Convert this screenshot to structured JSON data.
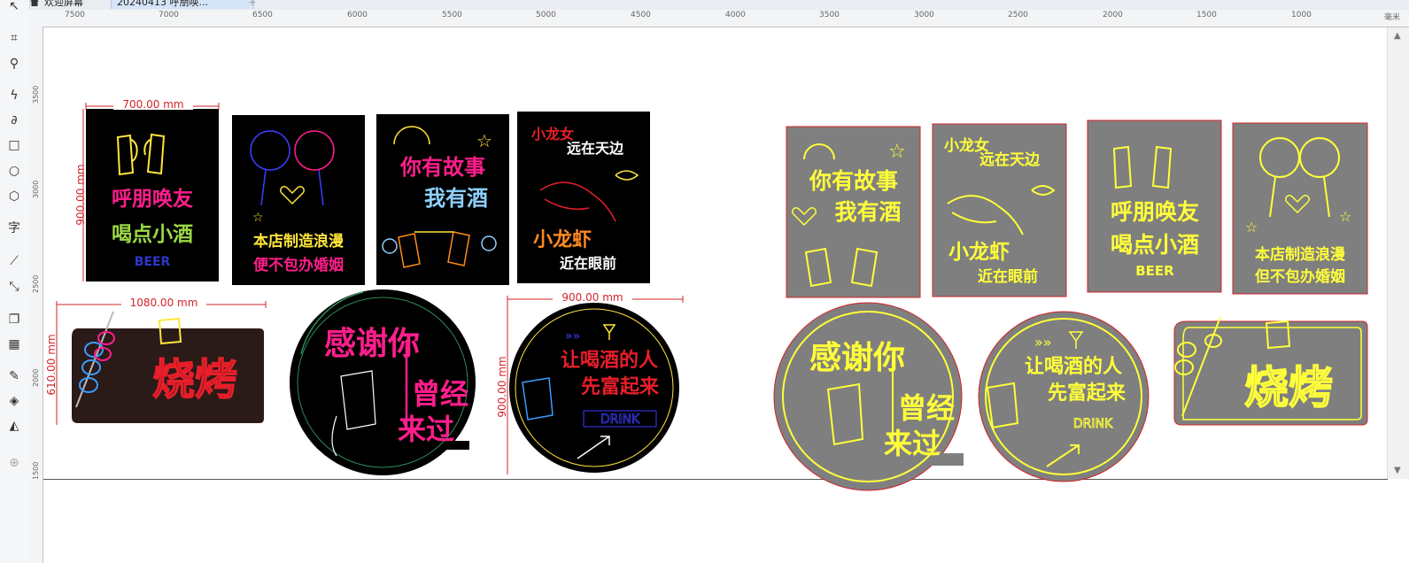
{
  "tabs": {
    "home": "欢迎屏幕",
    "doc": "20240413 呼朋唤..."
  },
  "ruler": {
    "h_labels": [
      "7500",
      "7000",
      "6500",
      "6000",
      "5500",
      "5000",
      "4500",
      "4000",
      "3500",
      "3000",
      "2500",
      "2000",
      "1500",
      "1000",
      "毫米"
    ],
    "v_labels": [
      "3500",
      "3000",
      "2500",
      "2000",
      "1500"
    ]
  },
  "dims": {
    "w700": "700.00 mm",
    "h900": "900.00 mm",
    "w1080": "1080.00 mm",
    "h610": "610.00 mm",
    "w900": "900.00 mm",
    "h900b": "900.00 mm"
  },
  "signs": {
    "s1": {
      "line1": "呼朋唤友",
      "line2": "喝点小酒",
      "line3": "BEER"
    },
    "s2": {
      "line1": "本店制造浪漫",
      "line2": "便不包办婚姻"
    },
    "s3": {
      "line1": "你有故事",
      "line2": "我有酒"
    },
    "s4": {
      "line1": "小龙女",
      "line2": "远在天边",
      "line3": "小龙虾",
      "line4": "近在眼前"
    },
    "s5": {
      "text": "烧烤"
    },
    "s6": {
      "line1": "感谢你",
      "line2": "曾经",
      "line3": "来过"
    },
    "s7": {
      "line1": "让喝酒的人",
      "line2": "先富起来",
      "line3": "DRINK"
    },
    "g1": {
      "line1": "你有故事",
      "line2": "我有酒"
    },
    "g2": {
      "line1": "小龙女",
      "line2": "远在天边",
      "line3": "小龙虾",
      "line4": "近在眼前"
    },
    "g3": {
      "line1": "呼朋唤友",
      "line2": "喝点小酒",
      "line3": "BEER"
    },
    "g4": {
      "line1": "本店制造浪漫",
      "line2": "但不包办婚姻"
    },
    "g5": {
      "line1": "感谢你",
      "line2": "曾经",
      "line3": "来过"
    },
    "g6": {
      "line1": "让喝酒的人",
      "line2": "先富起来",
      "line3": "DRINK"
    },
    "g7": {
      "text": "烧烤"
    }
  },
  "colors": {
    "dim": "#d2232a",
    "neon_pink": "#ff1e8c",
    "neon_yellow": "#ffff3a",
    "neon_green": "#9bd844",
    "gray_panel": "#7f7f7f"
  }
}
